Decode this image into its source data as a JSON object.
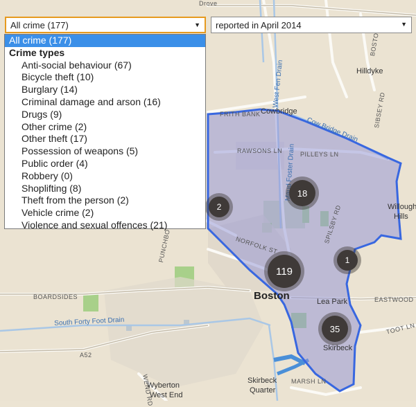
{
  "filters": {
    "crime_select_value": "All crime (177)",
    "period_select_value": "reported in April 2014"
  },
  "dropdown": {
    "options": [
      "All crime (177)",
      "Crime types",
      "Anti-social behaviour (67)",
      "Bicycle theft (10)",
      "Burglary (14)",
      "Criminal damage and arson (16)",
      "Drugs (9)",
      "Other crime (2)",
      "Other theft (17)",
      "Possession of weapons (5)",
      "Public order (4)",
      "Robbery (0)",
      "Shoplifting (8)",
      "Theft from the person (2)",
      "Vehicle crime (2)",
      "Violence and sexual offences (21)"
    ]
  },
  "clusters": [
    "18",
    "2",
    "119",
    "1",
    "35"
  ],
  "map_labels": {
    "drove": "Drove",
    "frith_bank": "FRITH BANK",
    "cowbridge": "Cowbridge",
    "rawsons_ln": "RAWSONS LN",
    "pilleys_ln": "PILLEYS LN",
    "hilldyke": "Hilldyke",
    "boston_rd": "BOSTON RD",
    "sibsey_rd": "SIBSEY RD",
    "west_fen_drain": "West Fen Drain",
    "maud_foster_drain": "Maud Foster Drain",
    "cowbridge_drain": "Cow Bridge Drain",
    "willoughby": "Willoughby",
    "hills": "Hills",
    "norfolk_st": "NORFOLK ST",
    "spilsby_rd": "SPILSBY RD",
    "punchbowl_ln": "PUNCHBOWL LN",
    "boston": "Boston",
    "lea_park": "Lea Park",
    "eastwood_rd": "EASTWOOD RD",
    "toot_ln": "TOOT LN",
    "boardsides": "BOARDSIDES",
    "south_forty_foot": "South Forty Foot Drain",
    "a52": "A52",
    "wend_rd": "WEND RD",
    "wyberton": "Wyberton",
    "west_end": "West End",
    "skirbeck": "Skirbeck",
    "skirbeck_quarter": "Skirbeck",
    "quarter": "Quarter",
    "marsh_ln": "MARSH LN"
  }
}
